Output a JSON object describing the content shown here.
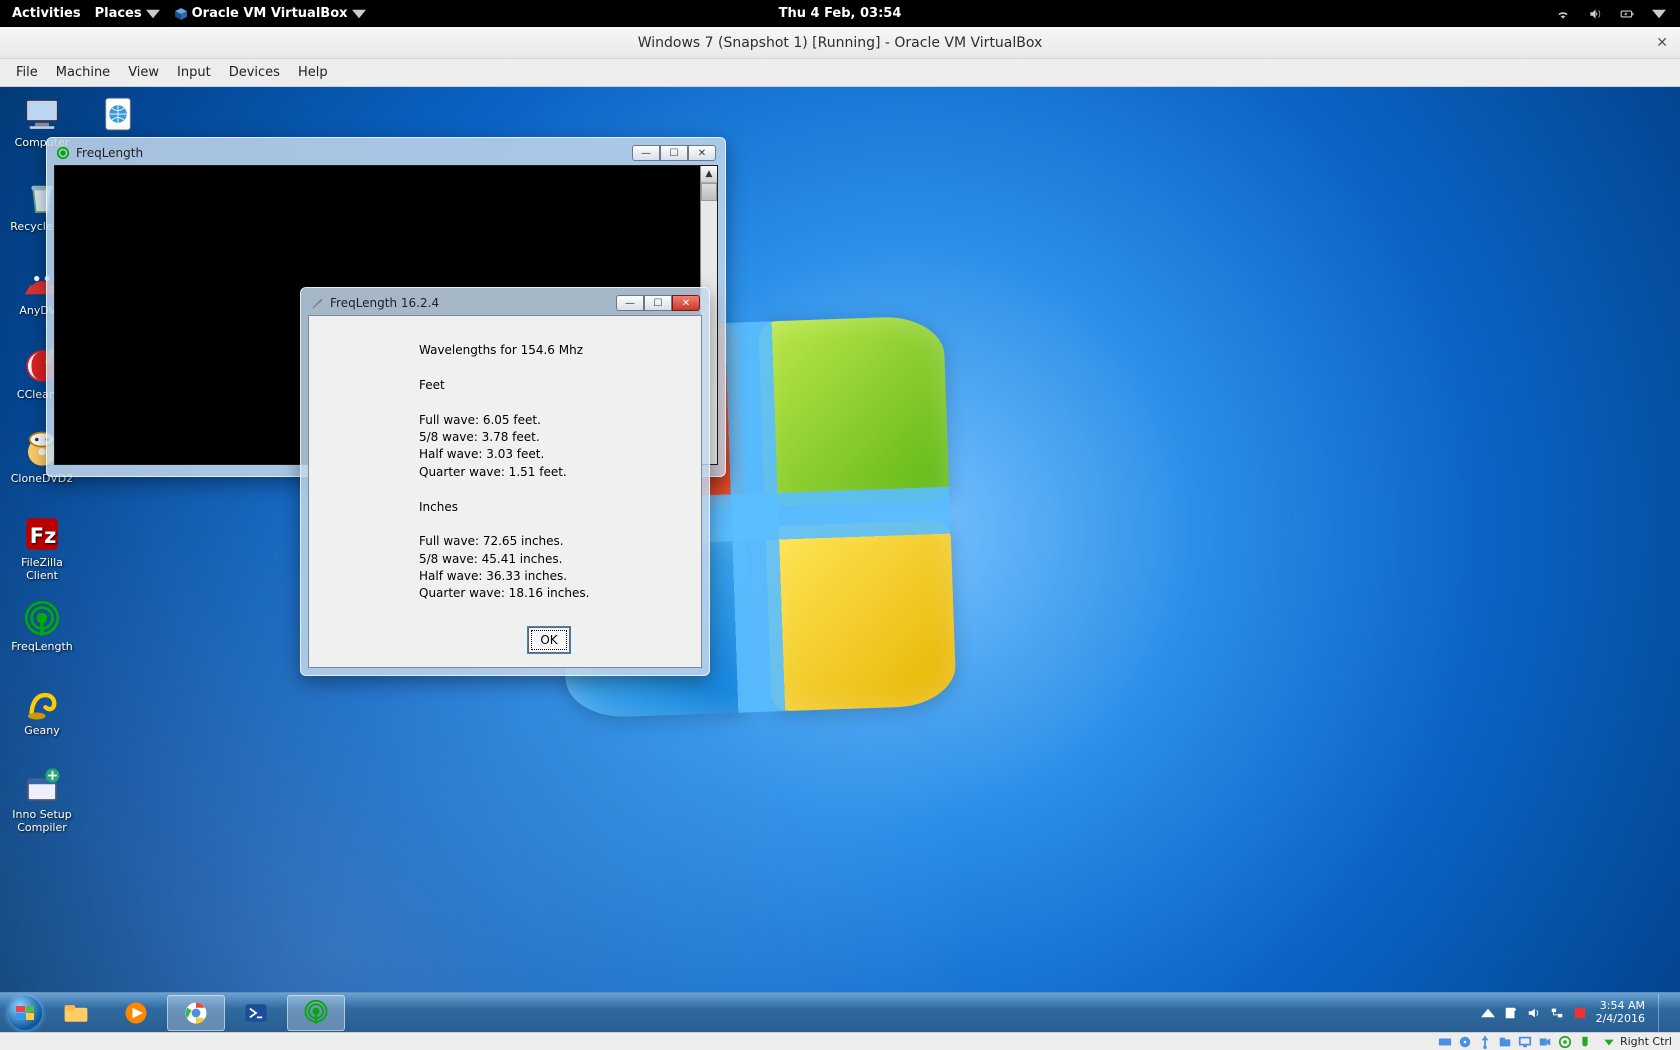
{
  "gnome": {
    "activities": "Activities",
    "places": "Places",
    "app": "Oracle VM VirtualBox",
    "clock": "Thu  4 Feb, 03:54"
  },
  "vbox": {
    "title": "Windows 7 (Snapshot 1) [Running] - Oracle VM VirtualBox",
    "menu": {
      "file": "File",
      "machine": "Machine",
      "view": "View",
      "input": "Input",
      "devices": "Devices",
      "help": "Help"
    },
    "hostkey": "Right Ctrl"
  },
  "desktop_icons": {
    "col1": [
      {
        "name": "computer",
        "label": "Computer"
      },
      {
        "name": "recycle-bin",
        "label": "Recycle Bin"
      },
      {
        "name": "anydvd",
        "label": "AnyDVD"
      },
      {
        "name": "ccleaner",
        "label": "CCleaner"
      },
      {
        "name": "clonedvd2",
        "label": "CloneDVD2"
      },
      {
        "name": "filezilla",
        "label": "FileZilla Client"
      },
      {
        "name": "freqlength",
        "label": "FreqLength"
      },
      {
        "name": "geany",
        "label": "Geany"
      },
      {
        "name": "inno-setup",
        "label": "Inno Setup Compiler"
      }
    ],
    "col2": [
      {
        "name": "shortcut",
        "label": ""
      }
    ]
  },
  "console_window": {
    "title": "FreqLength"
  },
  "dialog": {
    "title": "FreqLength 16.2.4",
    "heading": "Wavelengths for 154.6 Mhz",
    "section_feet": "Feet",
    "feet": {
      "full": "Full wave: 6.05 feet.",
      "five8": "5/8 wave: 3.78 feet.",
      "half": "Half wave: 3.03 feet.",
      "quarter": "Quarter wave: 1.51 feet."
    },
    "section_inches": "Inches",
    "inches": {
      "full": "Full wave: 72.65 inches.",
      "five8": "5/8 wave: 45.41 inches.",
      "half": "Half wave: 36.33 inches.",
      "quarter": "Quarter wave: 18.16 inches."
    },
    "ok": "OK"
  },
  "taskbar": {
    "tray_time": "3:54 AM",
    "tray_date": "2/4/2016"
  }
}
